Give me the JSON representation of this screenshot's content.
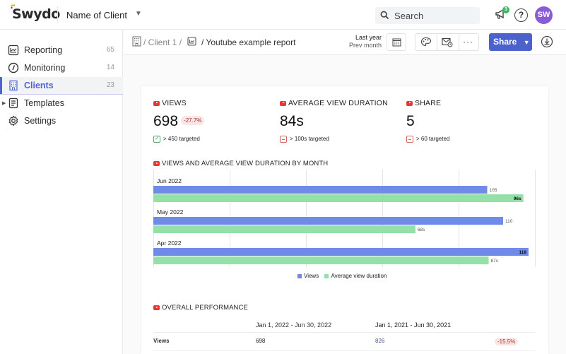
{
  "topbar": {
    "logo": "Swydo",
    "client_name": "Name of Client",
    "search_label": "Search",
    "notification_count": "3",
    "help_label": "?",
    "avatar_initials": "SW"
  },
  "sidebar": {
    "items": [
      {
        "label": "Reporting",
        "count": "65",
        "icon": "line-chart-icon"
      },
      {
        "label": "Monitoring",
        "count": "14",
        "icon": "gauge-icon"
      },
      {
        "label": "Clients",
        "count": "23",
        "icon": "building-icon",
        "active": true
      },
      {
        "label": "Templates",
        "count": "",
        "icon": "template-icon"
      },
      {
        "label": "Settings",
        "count": "",
        "icon": "gear-icon"
      }
    ]
  },
  "toolbar": {
    "breadcrumb": {
      "client": "/ Client 1 /",
      "report": "/ Youtube example report"
    },
    "date_range": {
      "primary": "Last year",
      "comparison": "Prev month"
    },
    "share_label": "Share",
    "more_label": "···"
  },
  "report": {
    "kpis": [
      {
        "title": "VIEWS",
        "value": "698",
        "change": "-27.7%",
        "target": "> 450 targeted",
        "target_met": true
      },
      {
        "title": "AVERAGE VIEW DURATION",
        "value": "84s",
        "change": "",
        "target": "> 100s targeted",
        "target_met": false
      },
      {
        "title": "SHARE",
        "value": "5",
        "change": "",
        "target": "> 60 targeted",
        "target_met": false
      }
    ],
    "chart_title": "VIEWS AND AVERAGE VIEW DURATION BY MONTH",
    "performance": {
      "title": "OVERALL PERFORMANCE",
      "columns": [
        "Jan 1, 2022 - Jun 30, 2022",
        "Jan 1, 2021 - Jun 30, 2021"
      ],
      "rows": [
        {
          "metric": "Views",
          "current": "698",
          "previous": "826",
          "change": "-15.5%"
        }
      ]
    }
  },
  "colors": {
    "accent": "#4b62cc",
    "views_bar": "#6f8ae8",
    "duration_bar": "#93e0a8",
    "negative": "#a33333",
    "youtube_red": "#e53935"
  },
  "chart_data": {
    "type": "bar",
    "orientation": "horizontal",
    "title": "VIEWS AND AVERAGE VIEW DURATION BY MONTH",
    "categories": [
      "Jun 2022",
      "May 2022",
      "Apr 2022"
    ],
    "series": [
      {
        "name": "Views",
        "values": [
          105,
          110,
          118
        ],
        "labels": [
          "105",
          "110",
          "118"
        ]
      },
      {
        "name": "Average view duration",
        "values": [
          96,
          68,
          87
        ],
        "labels": [
          "96s",
          "68s",
          "87s"
        ]
      }
    ],
    "xlim": [
      0,
      120
    ],
    "grid": true,
    "legend": "bottom-center"
  }
}
